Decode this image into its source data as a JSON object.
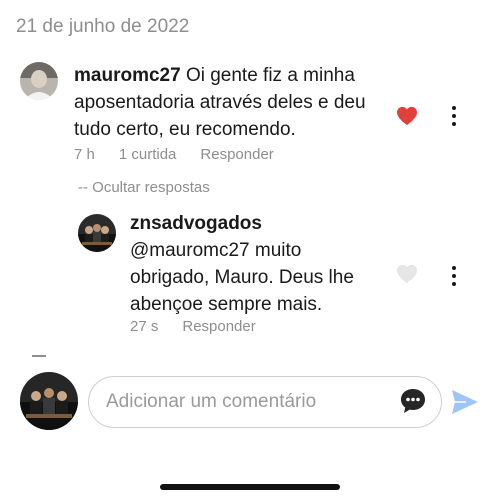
{
  "date_header": "21 de junho de 2022",
  "comments": [
    {
      "username": "mauromc27",
      "text": "Oi gente fiz a minha aposentadoria através deles e deu tudo certo, eu recomendo.",
      "time": "7 h",
      "likes": "1 curtida",
      "reply_label": "Responder",
      "liked": true,
      "avatar_icon": "user-photo-avatar"
    },
    {
      "username": "znsadvogados",
      "text": "@mauromc27 muito obrigado, Mauro. Deus lhe abençoe sempre mais.",
      "time": "27 s",
      "reply_label": "Responder",
      "liked": false,
      "avatar_icon": "office-photo-avatar"
    }
  ],
  "hide_replies_label": "-- Ocultar respostas",
  "composer": {
    "placeholder": "Adicionar um comentário",
    "emoji_icon": "speech-bubble-icon",
    "send_icon": "paper-plane-icon"
  },
  "colors": {
    "heart_active": "#ed4956",
    "heart_inactive": "#e6e6e6",
    "send": "#9ec5f7",
    "muted_text": "#8e8e8e"
  }
}
